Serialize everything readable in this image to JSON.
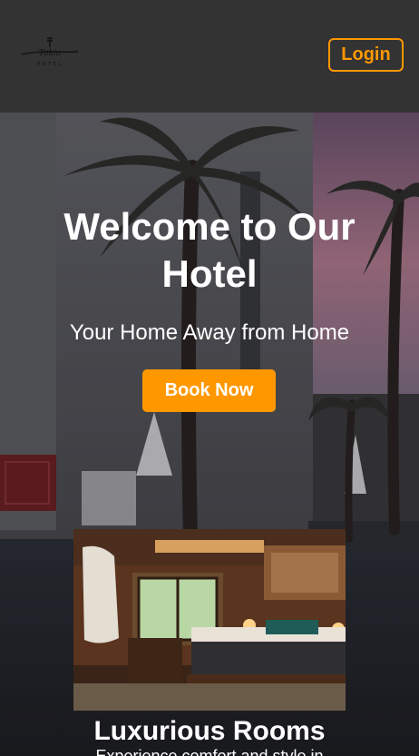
{
  "navbar": {
    "logo_text": "Tokio",
    "logo_subtext": "HOTEL",
    "login_label": "Login"
  },
  "hero": {
    "title": "Welcome to Our Hotel",
    "subtitle": "Your Home Away from Home",
    "cta_label": "Book Now"
  },
  "featured_room": {
    "title": "Luxurious Rooms",
    "description": "Experience comfort and style in"
  },
  "colors": {
    "accent": "#ff9800",
    "navbar_bg": "#333333",
    "text": "#ffffff"
  }
}
